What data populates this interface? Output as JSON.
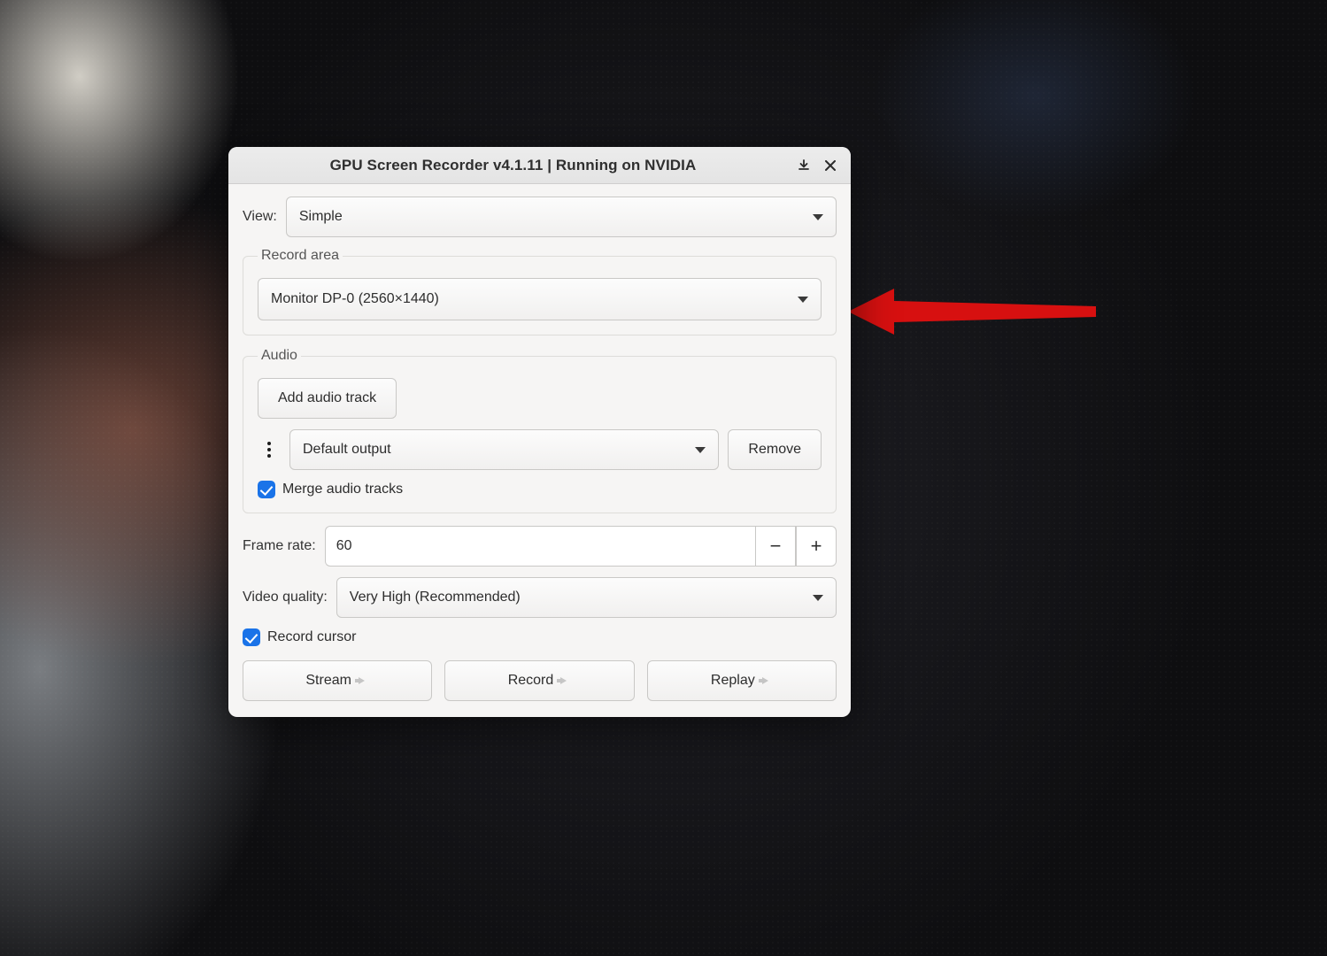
{
  "annotation": {
    "arrow_color": "#d71010"
  },
  "window": {
    "title": "GPU Screen Recorder v4.1.11 | Running on NVIDIA",
    "view_label": "View:",
    "view_value": "Simple",
    "record_area": {
      "legend": "Record area",
      "value": "Monitor DP-0 (2560×1440)"
    },
    "audio": {
      "legend": "Audio",
      "add_track_label": "Add audio track",
      "source_value": "Default output",
      "remove_label": "Remove",
      "merge_label": "Merge audio tracks",
      "merge_checked": true
    },
    "frame_rate": {
      "label": "Frame rate:",
      "value": "60"
    },
    "video_quality": {
      "label": "Video quality:",
      "value": "Very High (Recommended)"
    },
    "record_cursor": {
      "label": "Record cursor",
      "checked": true
    },
    "buttons": {
      "stream": "Stream",
      "record": "Record",
      "replay": "Replay"
    }
  }
}
